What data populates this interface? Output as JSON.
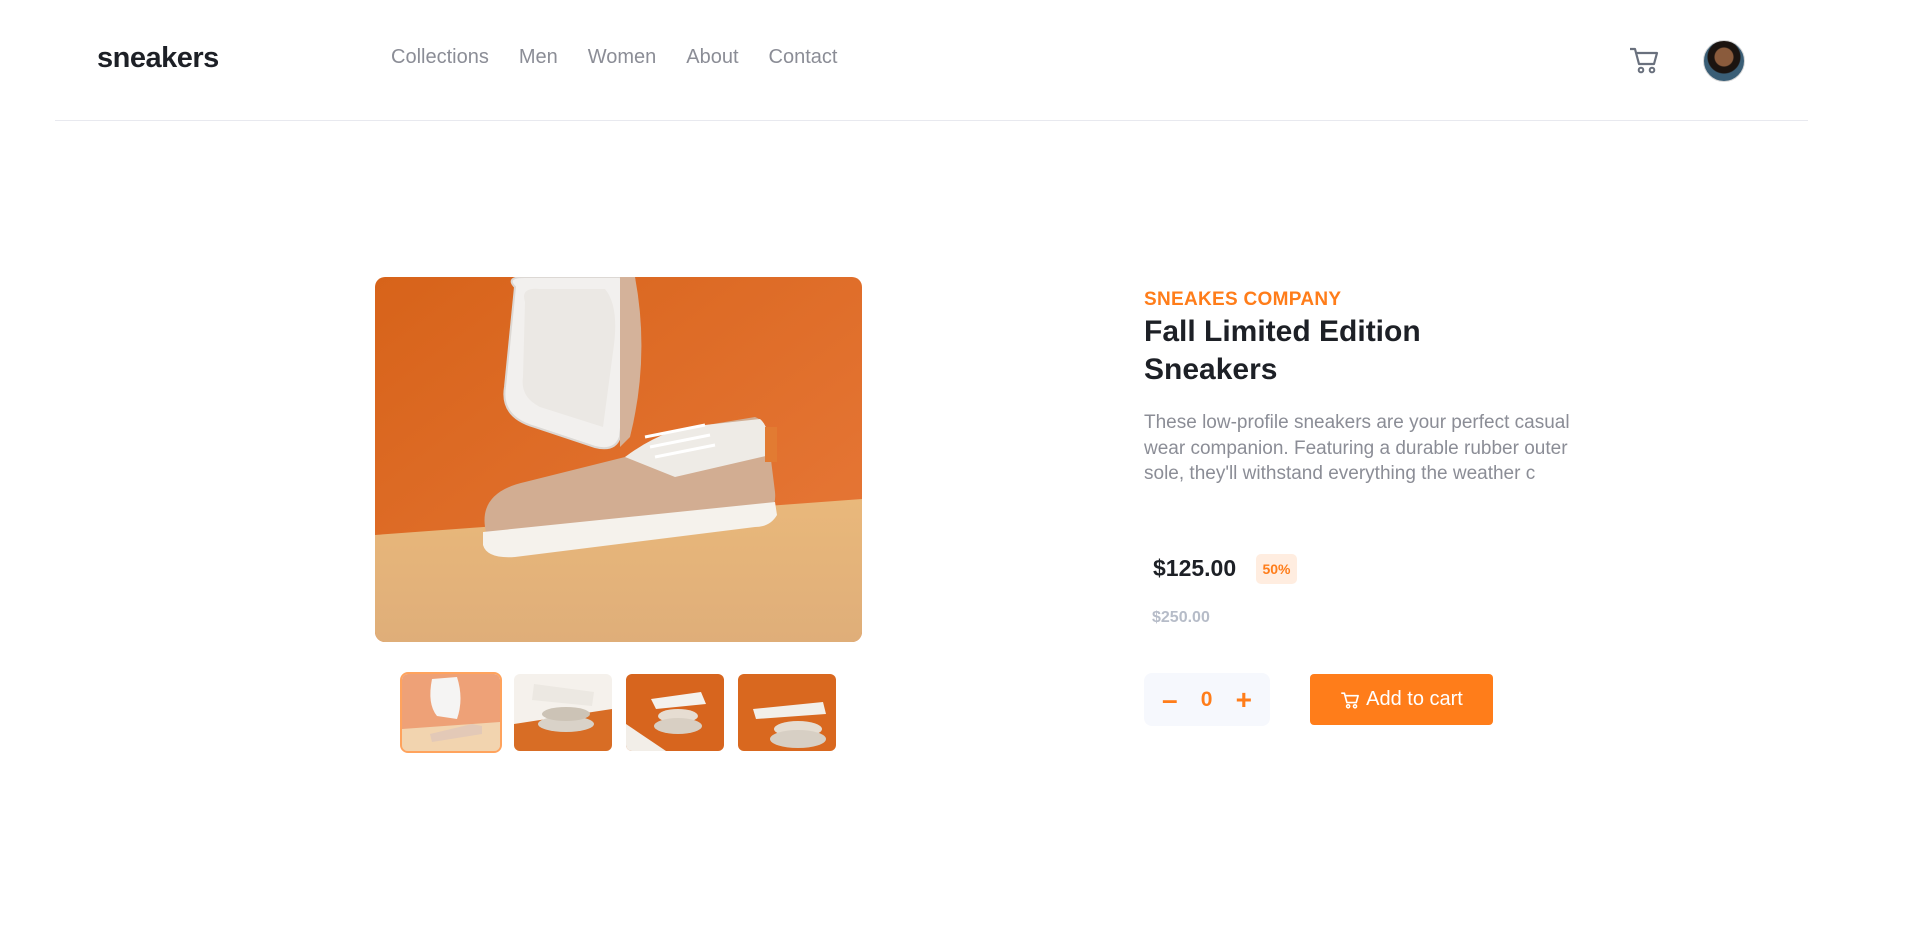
{
  "header": {
    "logo": "sneakers",
    "nav": [
      "Collections",
      "Men",
      "Women",
      "About",
      "Contact"
    ],
    "icons": {
      "cart": "cart-icon",
      "avatar": "avatar"
    }
  },
  "gallery": {
    "thumbnail_count": 4,
    "active_thumbnail": 1
  },
  "product": {
    "company": "SNEAKES COMPANY",
    "title": "Fall Limited Edition Sneakers",
    "description": "These low-profile sneakers are your perfect casual wear companion. Featuring a durable rubber outer sole, they'll withstand everything the weather c",
    "price": "$125.00",
    "discount": "50%",
    "old_price": "$250.00"
  },
  "cart_controls": {
    "minus": "–",
    "quantity": "0",
    "plus": "+",
    "add_label": "Add to cart"
  },
  "colors": {
    "accent": "#ff7d1a",
    "accent_pale": "#ffede0",
    "dark": "#1d2026",
    "muted": "#8b8d96"
  }
}
